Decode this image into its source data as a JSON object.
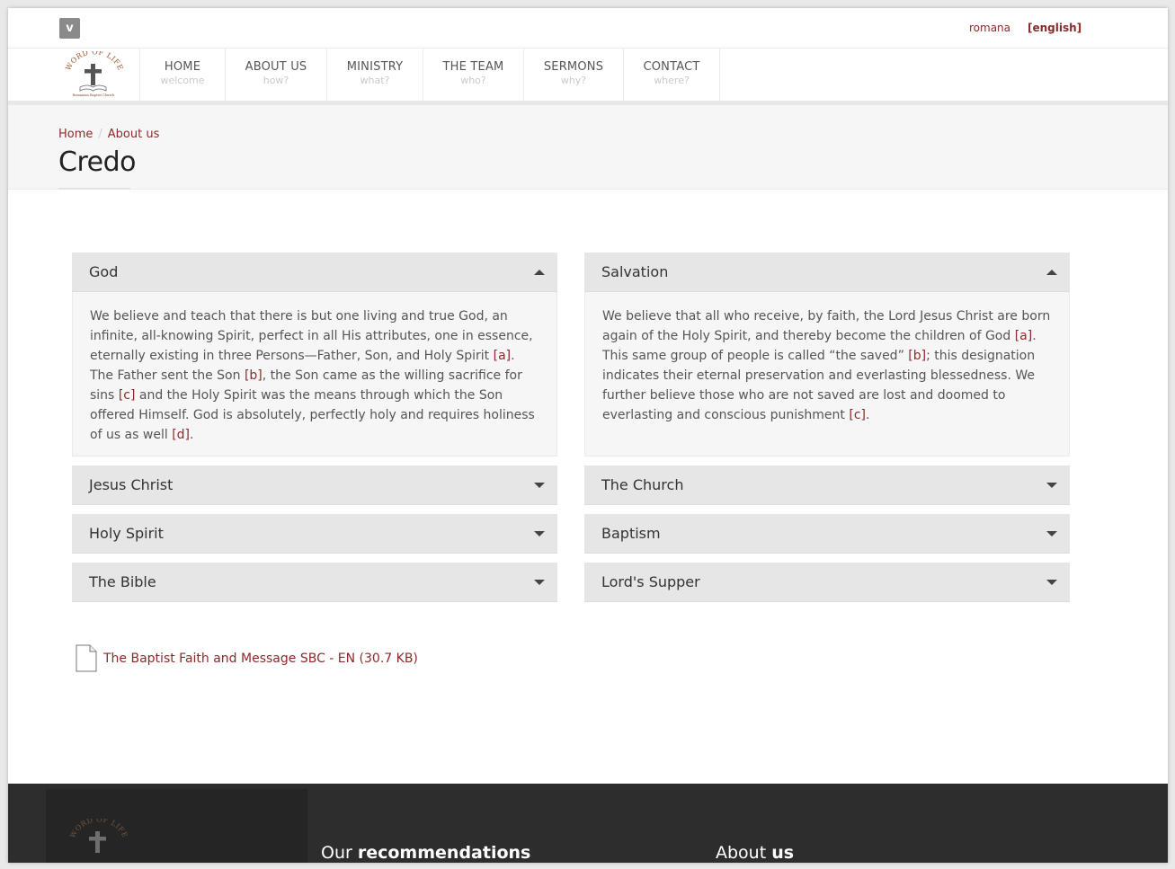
{
  "topbar": {
    "vimeo_glyph": "v",
    "lang_romana": "romana",
    "lang_english": "[english]"
  },
  "logo": {
    "text_top": "WORD OF LIFE",
    "text_bottom": "Romanian Baptist Church"
  },
  "nav": [
    {
      "label": "HOME",
      "sub": "welcome"
    },
    {
      "label": "ABOUT US",
      "sub": "how?"
    },
    {
      "label": "MINISTRY",
      "sub": "what?"
    },
    {
      "label": "THE TEAM",
      "sub": "who?"
    },
    {
      "label": "SERMONS",
      "sub": "why?"
    },
    {
      "label": "CONTACT",
      "sub": "where?"
    }
  ],
  "breadcrumb": {
    "home": "Home",
    "separator": "/",
    "current": "About us"
  },
  "page_title": "Credo",
  "accordion_left": {
    "open": {
      "title": "God",
      "parts": [
        "We believe and teach that there is but one living and true God, an infinite, all-knowing Spirit, perfect in all His attributes, one in essence, eternally existing in three Persons—Father, Son, and Holy Spirit ",
        "[a]",
        ". The Father sent the Son ",
        "[b]",
        ", the Son came as the willing sacrifice for sins ",
        "[c]",
        " and the Holy Spirit was the means through which the Son offered Himself. God is absolutely, perfectly holy and requires holiness of us as well ",
        "[d]",
        "."
      ]
    },
    "closed": [
      "Jesus Christ",
      "Holy Spirit",
      "The Bible"
    ]
  },
  "accordion_right": {
    "open": {
      "title": "Salvation",
      "parts": [
        "We believe that all who receive, by faith, the Lord Jesus Christ are born again of the Holy Spirit, and thereby become the children of God ",
        "[a]",
        ". This same group of people is called “the saved” ",
        "[b]",
        "; this designation indicates their eternal preservation and everlasting blessedness. We further believe those who are not saved are lost and doomed to everlasting and conscious punishment ",
        "[c]",
        "."
      ]
    },
    "closed": [
      "The Church",
      "Baptism",
      "Lord's Supper"
    ]
  },
  "download": {
    "label": "The Baptist Faith and Message SBC - EN (30.7 KB)"
  },
  "footer": {
    "rec_light": "Our ",
    "rec_bold": "recommendations",
    "about_light": "About ",
    "about_bold": "us"
  },
  "colors": {
    "accent": "#8b2a2a",
    "footer_bg": "#2d2d2d",
    "accordion_head": "#e6e6e6"
  }
}
